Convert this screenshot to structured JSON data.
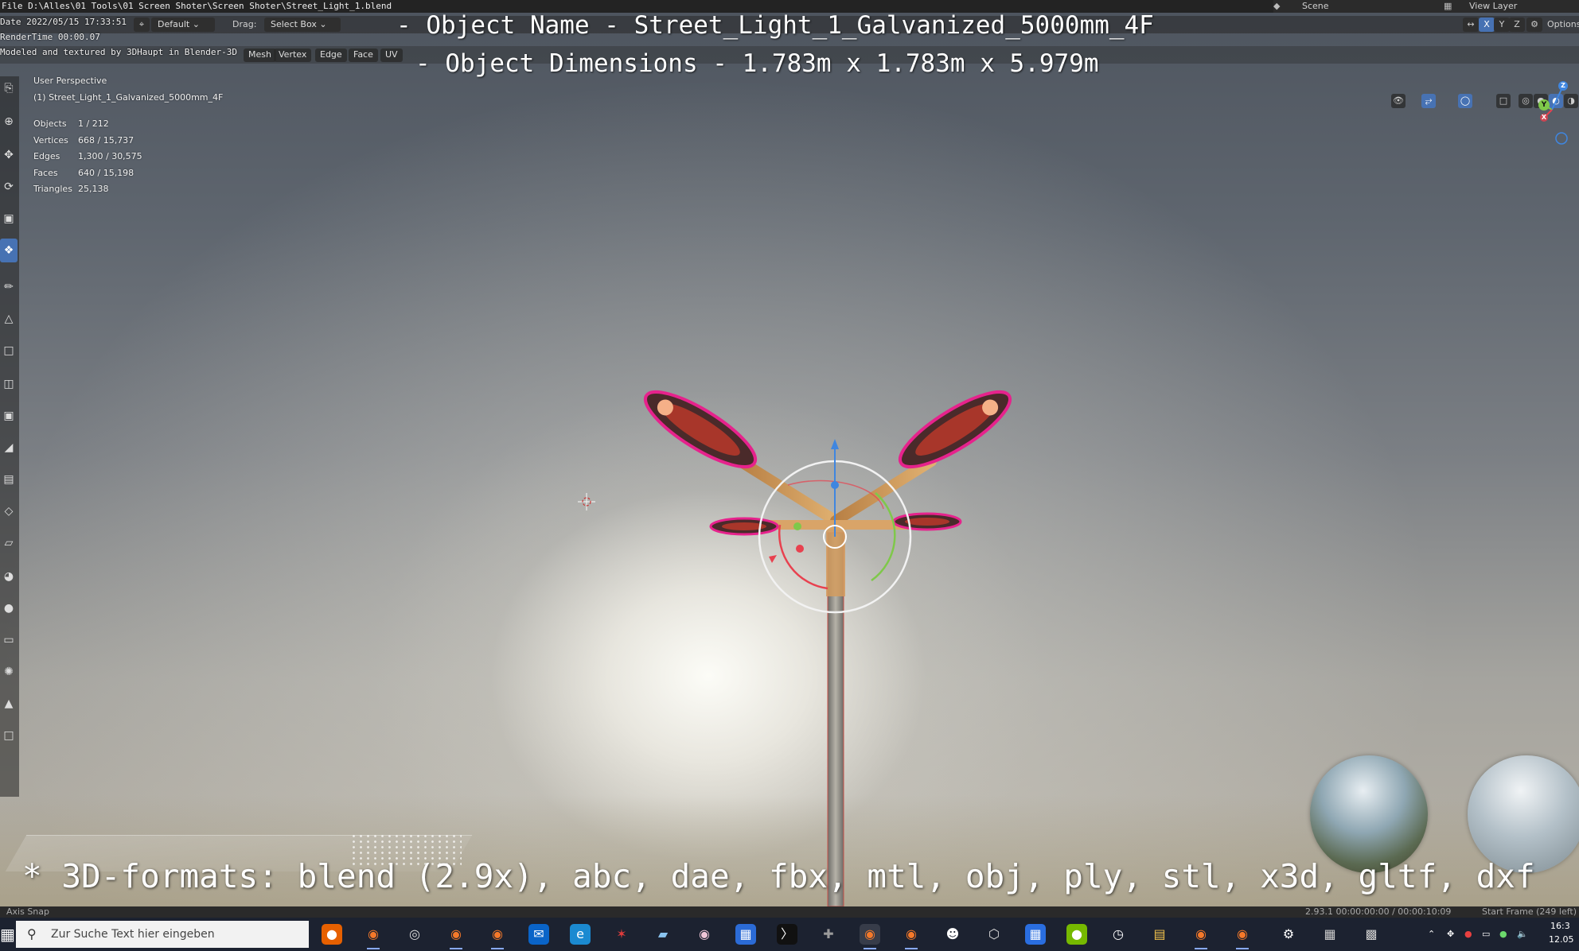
{
  "app": {
    "file_path": "File D:\\Alles\\01 Tools\\01 Screen Shoter\\Screen Shoter\\Street_Light_1.blend",
    "date": "Date 2022/05/15 17:33:51",
    "rendertime": "RenderTime 00:00.07",
    "modeled_by": "Modeled and textured by 3DHaupt in Blender-3D"
  },
  "topbar": {
    "scene_label": "Scene",
    "view_layer_label": "View Layer"
  },
  "tool_header": {
    "orientation_value": "Default",
    "drag_label": "Drag:",
    "drag_value": "Select Box",
    "options_label": "Options"
  },
  "viewport_header": {
    "modes": [
      "Mesh",
      "Vertex",
      "Edge",
      "Face",
      "UV"
    ],
    "axis_buttons": [
      "X",
      "Y",
      "Z"
    ]
  },
  "overlay": {
    "object_name_line": "- Object Name - Street_Light_1_Galvanized_5000mm_4F",
    "dimensions_line": "- Object Dimensions -  1.783m x 1.783m x 5.979m",
    "formats_line": "* 3D-formats: blend (2.9x), abc, dae, fbx, mtl, obj, ply, stl, x3d, gltf, dxf"
  },
  "viewport": {
    "perspective": "User Perspective",
    "active_object": "(1) Street_Light_1_Galvanized_5000mm_4F",
    "stats": [
      {
        "key": "Objects",
        "value": "1 / 212"
      },
      {
        "key": "Vertices",
        "value": "668 / 15,737"
      },
      {
        "key": "Edges",
        "value": "1,300 / 30,575"
      },
      {
        "key": "Faces",
        "value": "640 / 15,198"
      },
      {
        "key": "Triangles",
        "value": "25,138"
      }
    ],
    "gizmo_axes": {
      "x": "X",
      "y": "Y",
      "z": "Z"
    }
  },
  "statusbar": {
    "left_text": "Axis Snap",
    "version_info": "2.93.1  00:00:00:00 / 00:00:10:09",
    "frame_info": "Start Frame (249 left)"
  },
  "taskbar": {
    "search_placeholder": "Zur Suche Text hier eingeben",
    "clock_time": "16:3",
    "clock_date": "12.05"
  },
  "colors": {
    "accent_blue": "#4772b3",
    "taskbar_bg": "#1c2230",
    "header_bg": "#232323",
    "gizmo_x": "#e8414f",
    "gizmo_y": "#7fc84a",
    "gizmo_z": "#3f86e0"
  }
}
